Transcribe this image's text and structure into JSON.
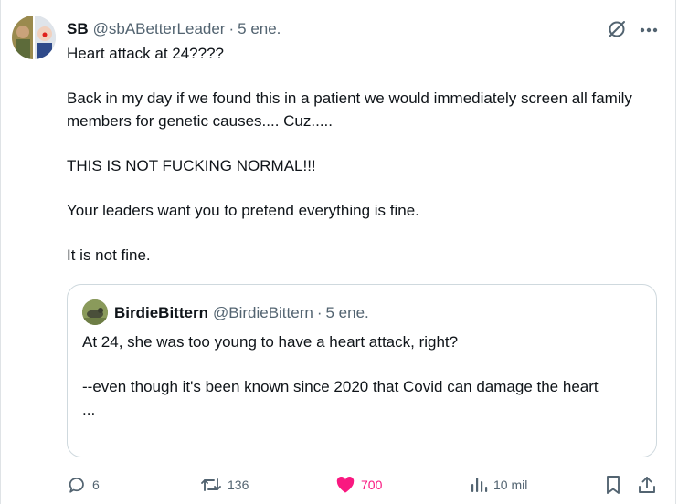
{
  "post": {
    "author_name": "SB",
    "handle": "@sbABetterLeader",
    "separator": "·",
    "date": "5 ene.",
    "text": "Heart attack at 24????\n\nBack in my day if we found this in a patient we would immediately screen all family members for genetic causes.... Cuz.....\n\nTHIS IS NOT FUCKING NORMAL!!!\n\nYour leaders want you to pretend everything is fine.\n\nIt is not fine."
  },
  "quote": {
    "author_name": "BirdieBittern",
    "handle": "@BirdieBittern",
    "separator": "·",
    "date": "5 ene.",
    "text": "At 24, she was too young to have a heart attack, right?\n\n--even though it's been known since 2020 that Covid can damage the heart\n..."
  },
  "actions": {
    "replies": "6",
    "reposts": "136",
    "likes": "700",
    "views": "10 mil"
  },
  "icons": {
    "reply": "reply-icon",
    "repost": "repost-icon",
    "like": "heart-icon",
    "views": "views-icon",
    "bookmark": "bookmark-icon",
    "share": "share-icon",
    "grok": "grok-icon",
    "more": "more-icon"
  },
  "colors": {
    "text": "#0f1419",
    "secondary": "#536471",
    "like_active": "#f91880",
    "border": "#cfd9de"
  }
}
